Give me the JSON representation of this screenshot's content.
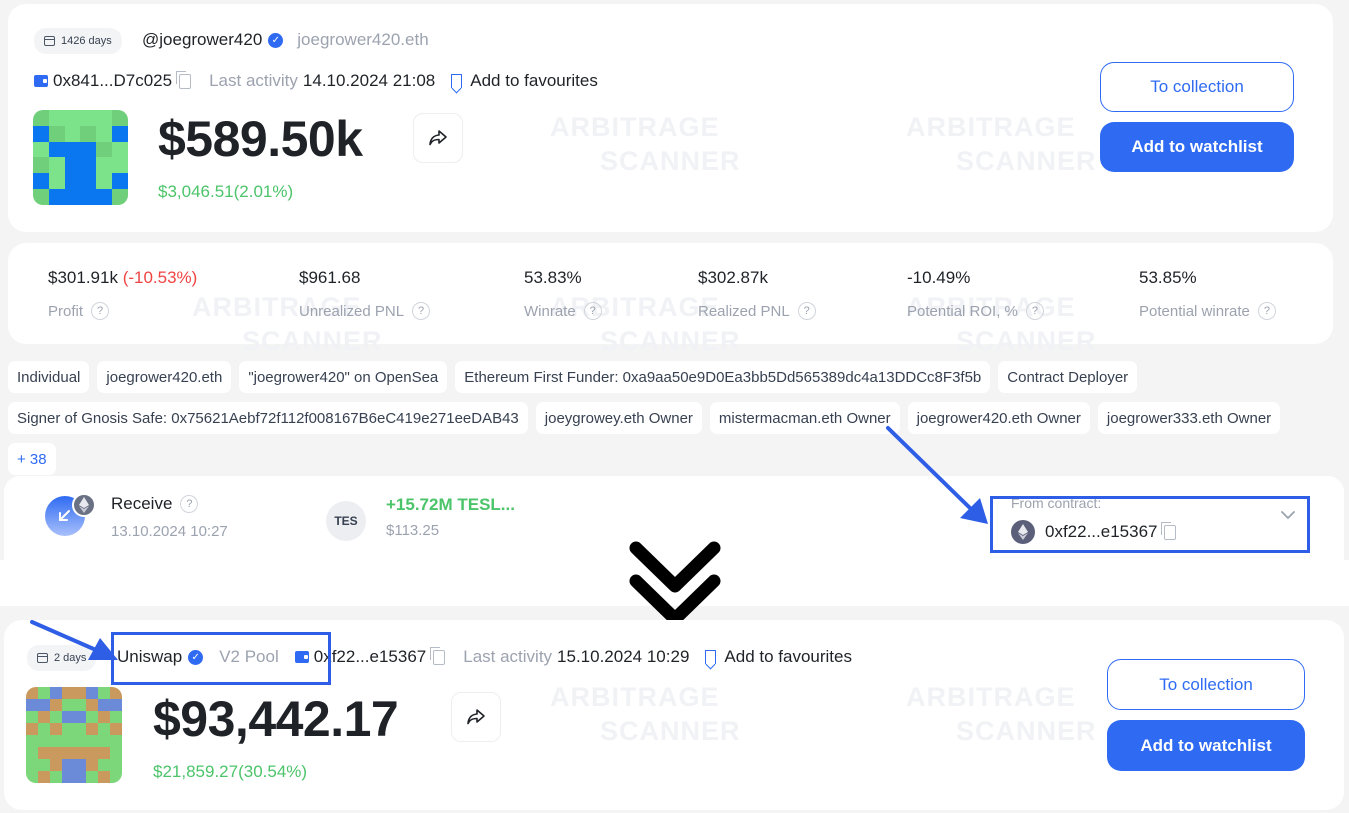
{
  "top_profile": {
    "age_badge": "1426 days",
    "username": "@joegrower420",
    "ens_name": "joegrower420.eth",
    "address": "0x841...D7c025",
    "last_activity_label": "Last activity",
    "last_activity_value": "14.10.2024 21:08",
    "favourites_label": "Add to favourites",
    "balance": "$589.50k",
    "balance_change": "$3,046.51(2.01%)",
    "to_collection_label": "To collection",
    "add_watchlist_label": "Add to watchlist"
  },
  "stats": [
    {
      "value": "$301.91k",
      "extra": "(-10.53%)",
      "label": "Profit"
    },
    {
      "value": "$961.68",
      "extra": "",
      "label": "Unrealized PNL"
    },
    {
      "value": "53.83%",
      "extra": "",
      "label": "Winrate"
    },
    {
      "value": "$302.87k",
      "extra": "",
      "label": "Realized PNL"
    },
    {
      "value": "-10.49%",
      "extra": "",
      "label": "Potential ROI, %"
    },
    {
      "value": "53.85%",
      "extra": "",
      "label": "Potential winrate"
    }
  ],
  "help_glyph": "?",
  "tags": [
    "Individual",
    "joegrower420.eth",
    "\"joegrower420\" on OpenSea",
    "Ethereum First Funder: 0xa9aa50e9D0Ea3bb5Dd565389dc4a13DDCc8F3f5b",
    "Contract Deployer",
    "Signer of Gnosis Safe: 0x75621Aebf72f112f008167B6eC419e271eeDAB43",
    "joeygrowey.eth Owner",
    "mistermacman.eth Owner",
    "joegrower420.eth Owner",
    "joegrower333.eth Owner"
  ],
  "tags_more": "+ 38",
  "transaction": {
    "type_label": "Receive",
    "timestamp": "13.10.2024 10:27",
    "token_badge": "TES",
    "amount": "+15.72M TESL...",
    "amount_usd": "$113.25",
    "from_contract_label": "From contract:",
    "from_contract_address": "0xf22...e15367"
  },
  "bottom_profile": {
    "age_badge": "2 days",
    "name": "Uniswap",
    "tag": "V2 Pool",
    "address": "0xf22...e15367",
    "last_activity_label": "Last activity",
    "last_activity_value": "15.10.2024 10:29",
    "favourites_label": "Add to favourites",
    "balance": "$93,442.17",
    "balance_change": "$21,859.27(30.54%)",
    "to_collection_label": "To collection",
    "add_watchlist_label": "Add to watchlist"
  },
  "watermark": {
    "line1": "ARBITRAGE",
    "line2": "SCANNER"
  },
  "colors": {
    "accent": "#2f6bf2",
    "positive": "#4cc46a",
    "negative": "#ef4444",
    "annotation": "#2f5ee6"
  }
}
